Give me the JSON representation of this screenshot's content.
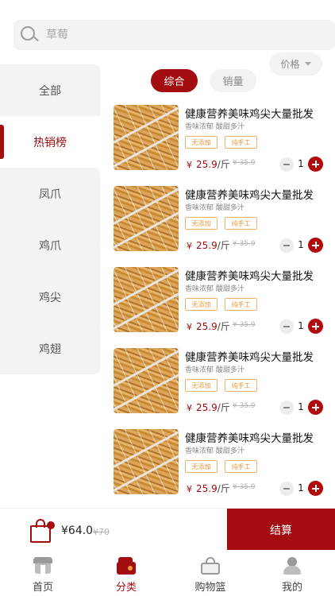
{
  "search": {
    "placeholder": "草莓"
  },
  "sidebar": {
    "items": [
      {
        "label": "全部"
      },
      {
        "label": "热销榜"
      },
      {
        "label": "凤爪"
      },
      {
        "label": "鸡爪"
      },
      {
        "label": "鸡尖"
      },
      {
        "label": "鸡翅"
      }
    ],
    "active_index": 1
  },
  "sort_tabs": [
    {
      "label": "综合"
    },
    {
      "label": "销量"
    },
    {
      "label": "价格"
    }
  ],
  "products": [
    {
      "title": "健康营养美味鸡尖大量批发",
      "subtitle": "香味浓郁 酸甜多汁",
      "tags": [
        "无添加",
        "纯手工"
      ],
      "currency": "¥",
      "price": "25.9",
      "unit": "/斤",
      "old_price": "¥ 35.9",
      "qty": "1"
    },
    {
      "title": "健康营养美味鸡尖大量批发",
      "subtitle": "香味浓郁 酸甜多汁",
      "tags": [
        "无添加",
        "纯手工"
      ],
      "currency": "¥",
      "price": "25.9",
      "unit": "/斤",
      "old_price": "¥ 35.9",
      "qty": "1"
    },
    {
      "title": "健康营养美味鸡尖大量批发",
      "subtitle": "香味浓郁 酸甜多汁",
      "tags": [
        "无添加",
        "纯手工"
      ],
      "currency": "¥",
      "price": "25.9",
      "unit": "/斤",
      "old_price": "¥ 35.9",
      "qty": "1"
    },
    {
      "title": "健康营养美味鸡尖大量批发",
      "subtitle": "香味浓郁 酸甜多汁",
      "tags": [
        "无添加",
        "纯手工"
      ],
      "currency": "¥",
      "price": "25.9",
      "unit": "/斤",
      "old_price": "¥ 35.9",
      "qty": "1"
    },
    {
      "title": "健康营养美味鸡尖大量批发",
      "subtitle": "香味浓郁 酸甜多汁",
      "tags": [
        "无添加",
        "纯手工"
      ],
      "currency": "¥",
      "price": "25.9",
      "unit": "/斤",
      "old_price": "¥ 35.9",
      "qty": "1"
    }
  ],
  "cart": {
    "total": "¥64.0",
    "original_total": "¥70",
    "checkout_label": "结算"
  },
  "tabbar": {
    "items": [
      {
        "label": "首页",
        "icon": "home-icon"
      },
      {
        "label": "分类",
        "icon": "category-icon"
      },
      {
        "label": "购物篮",
        "icon": "basket-icon"
      },
      {
        "label": "我的",
        "icon": "profile-icon"
      }
    ],
    "active_index": 1
  },
  "colors": {
    "accent": "#a30d10",
    "tag": "#e79a3c",
    "background_gray": "#f3f3f4"
  }
}
